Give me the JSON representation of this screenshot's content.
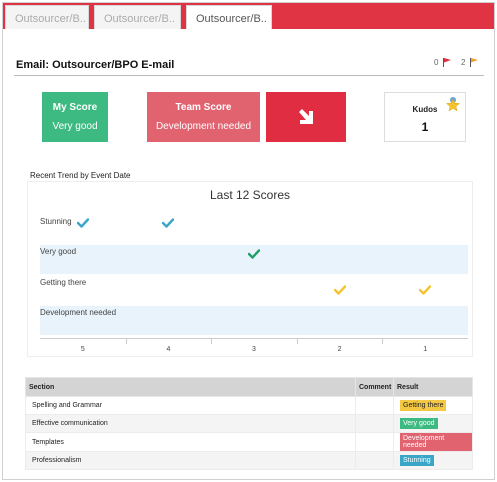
{
  "tabs": [
    {
      "label": "Outsourcer/B..",
      "active": false
    },
    {
      "label": "Outsourcer/B..",
      "active": false
    },
    {
      "label": "Outsourcer/B..",
      "active": true
    }
  ],
  "header": {
    "title": "Email: Outsourcer/BPO E-mail",
    "red_flag_count": "0",
    "orange_flag_count": "2"
  },
  "cards": {
    "my_score": {
      "title": "My Score",
      "value": "Very good",
      "color": "#3dba82"
    },
    "team_score": {
      "title": "Team Score",
      "value": "Development needed",
      "color": "#e26370"
    },
    "trend": {
      "icon": "arrow-down-right-icon",
      "color": "#e02d42"
    },
    "kudos": {
      "label": "Kudos",
      "value": "1",
      "icon": "star-medal-icon"
    }
  },
  "trend_label": "Recent Trend by Event Date",
  "chart_data": {
    "type": "scatter",
    "title": "Last 12 Scores",
    "y_categories": [
      "Development needed",
      "Getting there",
      "Very good",
      "Stunning"
    ],
    "x_ticks": [
      "5",
      "4",
      "3",
      "2",
      "1"
    ],
    "points": [
      {
        "x": "5",
        "y": "Stunning",
        "color": "#3aa6c7"
      },
      {
        "x": "4",
        "y": "Stunning",
        "color": "#3aa6c7"
      },
      {
        "x": "3",
        "y": "Very good",
        "color": "#1f9e6a"
      },
      {
        "x": "2",
        "y": "Getting there",
        "color": "#f2c530"
      },
      {
        "x": "1",
        "y": "Getting there",
        "color": "#f2c530"
      }
    ]
  },
  "table": {
    "headers": [
      "Section",
      "Comment",
      "Result"
    ],
    "rows": [
      {
        "section": "Spelling and Grammar",
        "comment": "",
        "result": "Getting there",
        "color": "#f4c842"
      },
      {
        "section": "Effective communication",
        "comment": "",
        "result": "Very good",
        "color": "#3dba82"
      },
      {
        "section": "Templates",
        "comment": "",
        "result": "Development needed",
        "color": "#e26370"
      },
      {
        "section": "Professionalism",
        "comment": "",
        "result": "Stunning",
        "color": "#3aa6c7"
      }
    ]
  }
}
